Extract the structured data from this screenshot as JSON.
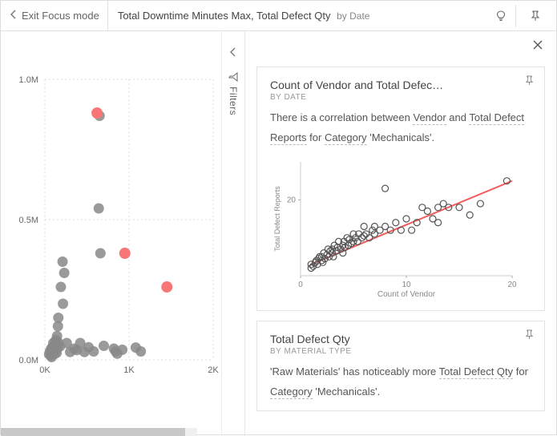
{
  "header": {
    "exit_label": "Exit Focus mode",
    "title_main": "Total Downtime Minutes Max, Total Defect Qty",
    "title_sub": "by Date"
  },
  "filters": {
    "label": "Filters"
  },
  "right": {
    "close": "×"
  },
  "card1": {
    "title": "Count of Vendor and Total Defec…",
    "subtitle": "BY DATE",
    "text_pre": "There is a correlation between ",
    "term_vendor": "Vendor",
    "text_and": " and ",
    "term_tdr": "Total Defect Reports",
    "text_for": " for ",
    "term_category": "Category",
    "text_mech": " 'Mechanicals'."
  },
  "card2": {
    "title": "Total Defect Qty",
    "subtitle": "BY MATERIAL TYPE",
    "text_pre": "'Raw Materials' has noticeably more ",
    "term_tdq": "Total Defect Qty",
    "text_for": " for ",
    "term_category": "Category",
    "text_mech": " 'Mechanicals'."
  },
  "chart_data": [
    {
      "type": "scatter",
      "view": "left_main_scatter",
      "xlabel": "",
      "ylabel": "",
      "x_ticks": [
        "0K",
        "1K",
        "2K"
      ],
      "y_ticks": [
        "0.0M",
        "0.5M",
        "1.0M"
      ],
      "x_range": [
        0,
        2000
      ],
      "y_range": [
        0,
        1000000
      ],
      "series": [
        {
          "name": "normal",
          "color": "#888888",
          "points": [
            [
              50,
              20000
            ],
            [
              60,
              30000
            ],
            [
              70,
              15000
            ],
            [
              75,
              40000
            ],
            [
              80,
              10000
            ],
            [
              90,
              45000
            ],
            [
              100,
              60000
            ],
            [
              110,
              20000
            ],
            [
              120,
              55000
            ],
            [
              125,
              30000
            ],
            [
              130,
              70000
            ],
            [
              140,
              25000
            ],
            [
              145,
              85000
            ],
            [
              150,
              44000
            ],
            [
              155,
              120000
            ],
            [
              158,
              62000
            ],
            [
              160,
              150000
            ],
            [
              180,
              48000
            ],
            [
              190,
              260000
            ],
            [
              210,
              350000
            ],
            [
              215,
              200000
            ],
            [
              230,
              310000
            ],
            [
              260,
              60000
            ],
            [
              300,
              28000
            ],
            [
              350,
              40000
            ],
            [
              380,
              35000
            ],
            [
              420,
              60000
            ],
            [
              470,
              28000
            ],
            [
              520,
              45000
            ],
            [
              580,
              30000
            ],
            [
              640,
              540000
            ],
            [
              650,
              870000
            ],
            [
              660,
              380000
            ],
            [
              700,
              50000
            ],
            [
              820,
              40000
            ],
            [
              840,
              30000
            ],
            [
              860,
              22000
            ],
            [
              920,
              36000
            ],
            [
              1080,
              44000
            ],
            [
              1140,
              30000
            ]
          ]
        },
        {
          "name": "highlighted",
          "color": "#f87676",
          "points": [
            [
              620,
              880000
            ],
            [
              950,
              380000
            ],
            [
              1450,
              260000
            ]
          ]
        }
      ]
    },
    {
      "type": "scatter",
      "view": "card1_insight_scatter",
      "title": "Count of Vendor and Total Defect Reports",
      "xlabel": "Count of Vendor",
      "ylabel": "Total Defect Reports",
      "x_range": [
        0,
        20
      ],
      "y_range": [
        0,
        30
      ],
      "x_ticks": [
        0,
        10,
        20
      ],
      "y_ticks": [
        20
      ],
      "trend": {
        "type": "linear",
        "p1": [
          1,
          3
        ],
        "p2": [
          20,
          25
        ]
      },
      "points": [
        [
          1,
          2
        ],
        [
          1,
          3
        ],
        [
          1.2,
          2.5
        ],
        [
          1.4,
          3.5
        ],
        [
          1.5,
          4
        ],
        [
          1.6,
          3
        ],
        [
          1.7,
          4.5
        ],
        [
          1.8,
          5
        ],
        [
          2,
          4
        ],
        [
          2,
          5
        ],
        [
          2.1,
          3.5
        ],
        [
          2.2,
          6
        ],
        [
          2.3,
          4.5
        ],
        [
          2.5,
          5.5
        ],
        [
          2.6,
          7
        ],
        [
          2.7,
          5
        ],
        [
          2.8,
          6.5
        ],
        [
          3,
          6
        ],
        [
          3,
          7
        ],
        [
          3.1,
          5
        ],
        [
          3.2,
          8
        ],
        [
          3.4,
          6.5
        ],
        [
          3.5,
          7.5
        ],
        [
          3.6,
          9
        ],
        [
          3.8,
          7
        ],
        [
          4,
          8
        ],
        [
          4,
          6
        ],
        [
          4.1,
          9
        ],
        [
          4.2,
          7.5
        ],
        [
          4.4,
          10
        ],
        [
          4.5,
          8
        ],
        [
          4.6,
          9.5
        ],
        [
          4.8,
          8.5
        ],
        [
          5,
          9
        ],
        [
          5,
          11
        ],
        [
          5.2,
          10
        ],
        [
          5.4,
          9
        ],
        [
          5.5,
          11
        ],
        [
          5.8,
          10
        ],
        [
          6,
          10.5
        ],
        [
          6,
          13
        ],
        [
          6.2,
          11
        ],
        [
          6.5,
          10
        ],
        [
          6.8,
          12
        ],
        [
          7,
          13
        ],
        [
          7,
          11
        ],
        [
          7.5,
          12
        ],
        [
          8,
          13
        ],
        [
          8,
          23
        ],
        [
          8.5,
          12
        ],
        [
          9,
          14
        ],
        [
          9.5,
          12
        ],
        [
          10,
          15
        ],
        [
          10.5,
          12
        ],
        [
          11,
          14
        ],
        [
          11.5,
          18
        ],
        [
          12,
          17
        ],
        [
          12.5,
          15
        ],
        [
          13,
          14
        ],
        [
          13,
          18
        ],
        [
          13.5,
          19
        ],
        [
          14,
          18
        ],
        [
          15,
          18
        ],
        [
          16,
          16
        ],
        [
          17,
          19
        ],
        [
          19.5,
          25
        ]
      ]
    }
  ]
}
